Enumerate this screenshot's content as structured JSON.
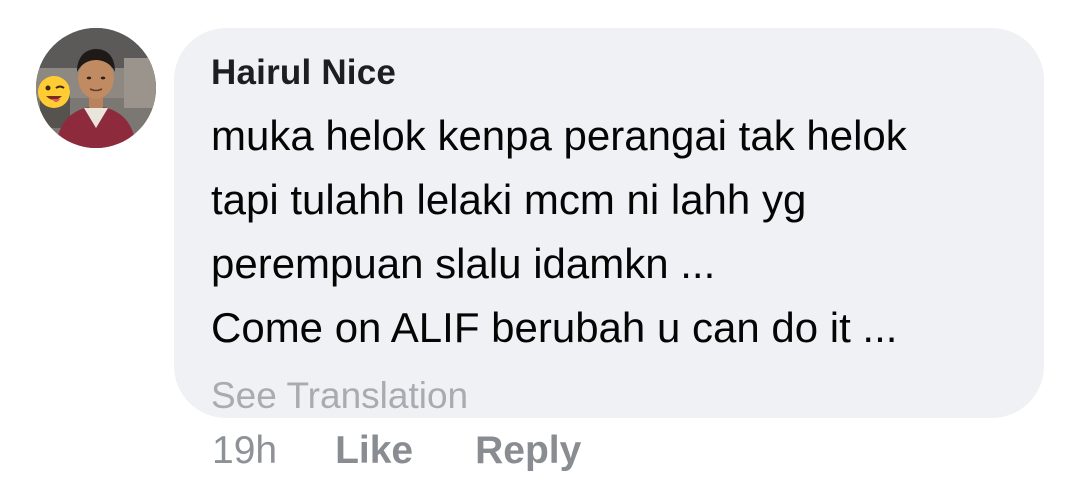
{
  "comment": {
    "author": "Hairul Nice",
    "body_lines": [
      "muka helok kenpa perangai tak helok",
      "tapi tulahh lelaki mcm ni lahh yg",
      "perempuan slalu idamkn ...",
      "Come on ALIF berubah u can do it ..."
    ],
    "see_translation": "See Translation",
    "time": "19h",
    "like_label": "Like",
    "reply_label": "Reply"
  },
  "colors": {
    "bubble_bg": "#f0f1f4",
    "author_text": "#1c1e21",
    "body_text": "#050505",
    "muted_text": "#8a8d91"
  },
  "icons": {
    "avatar_emoji": "winking-face-icon"
  }
}
